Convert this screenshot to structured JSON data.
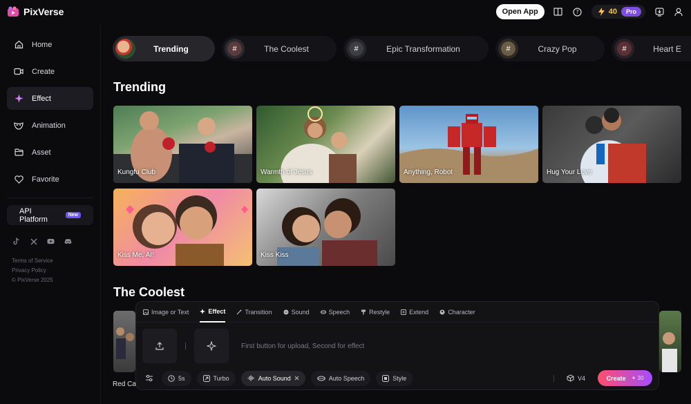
{
  "app": {
    "name": "PixVerse"
  },
  "topbar": {
    "open_app": "Open App",
    "credits": "40",
    "pro": "Pro"
  },
  "sidebar": {
    "items": [
      {
        "label": "Home",
        "icon": "home-icon"
      },
      {
        "label": "Create",
        "icon": "video-camera-icon"
      },
      {
        "label": "Effect",
        "icon": "sparkle-icon",
        "active": true
      },
      {
        "label": "Animation",
        "icon": "mask-icon"
      },
      {
        "label": "Asset",
        "icon": "folder-icon"
      },
      {
        "label": "Favorite",
        "icon": "heart-icon"
      }
    ],
    "api": {
      "label": "API Platform",
      "badge": "New"
    },
    "socials": [
      "tiktok-icon",
      "x-icon",
      "youtube-icon",
      "discord-icon"
    ],
    "footer": {
      "terms": "Terms of Service",
      "privacy": "Privacy Policy",
      "copyright": "© PixVerse 2025"
    }
  },
  "chips": [
    {
      "label": "Trending",
      "active": true
    },
    {
      "label": "The Coolest"
    },
    {
      "label": "Epic Transformation"
    },
    {
      "label": "Crazy Pop"
    },
    {
      "label": "Heart E"
    }
  ],
  "sections": {
    "trending": {
      "title": "Trending",
      "cards": [
        "Kungfu Club",
        "Warmth of Jesus",
        "Anything, Robot",
        "Hug Your Love",
        "Kiss Me, AI!",
        "Kiss Kiss"
      ]
    },
    "coolest": {
      "title": "The Coolest",
      "partial_card": "Red Ca"
    }
  },
  "composer": {
    "tabs": [
      "Image or Text",
      "Effect",
      "Transition",
      "Sound",
      "Speech",
      "Restyle",
      "Extend",
      "Character"
    ],
    "active_tab": "Effect",
    "hint": "First button for upload, Second for effect",
    "options": {
      "duration": "5s",
      "turbo": "Turbo",
      "auto_sound": "Auto Sound",
      "auto_speech": "Auto Speech",
      "style": "Style"
    },
    "model": "V4",
    "create": "Create",
    "cost": "30"
  },
  "colors": {
    "accent_pro": "#7d4fe0",
    "credit": "#f5c542",
    "create_start": "#ff4d6d",
    "create_end": "#a54dff"
  }
}
